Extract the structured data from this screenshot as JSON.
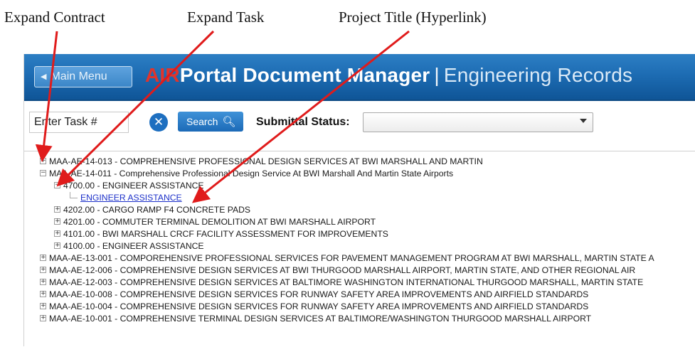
{
  "callouts": [
    "Expand Contract",
    "Expand Task",
    "Project Title (Hyperlink)"
  ],
  "header": {
    "main_menu_label": "Main Menu",
    "title_logo": "AIR",
    "title_rest": "Portal Document Manager",
    "title_separator": "|",
    "title_sub": "Engineering Records"
  },
  "toolbar": {
    "task_placeholder": "Enter Task #",
    "clear_symbol": "✕",
    "search_label": "Search",
    "status_label": "Submittal Status:",
    "status_value": ""
  },
  "tree": {
    "nodes": [
      {
        "toggle": "+",
        "text": "MAA-AE-14-013 - COMPREHENSIVE PROFESSIONAL DESIGN SERVICES AT BWI MARSHALL AND MARTIN"
      },
      {
        "toggle": "−",
        "text": "MAA-AE-14-011 - Comprehensive Professional Design Service At BWI Marshall And Martin State Airports"
      },
      {
        "toggle": "−",
        "text": "4700.00 - ENGINEER ASSISTANCE"
      },
      {
        "link": true,
        "text": "ENGINEER ASSISTANCE"
      },
      {
        "toggle": "+",
        "text": "4202.00 - CARGO RAMP F4 CONCRETE PADS"
      },
      {
        "toggle": "+",
        "text": "4201.00 - COMMUTER TERMINAL DEMOLITION AT BWI MARSHALL AIRPORT"
      },
      {
        "toggle": "+",
        "text": "4101.00 - BWI MARSHALL CRCF FACILITY ASSESSMENT FOR IMPROVEMENTS"
      },
      {
        "toggle": "+",
        "text": "4100.00 - ENGINEER ASSISTANCE"
      },
      {
        "toggle": "+",
        "text": "MAA-AE-13-001 - COMPOREHENSIVE PROFESSIONAL SERVICES FOR PAVEMENT MANAGEMENT PROGRAM AT BWI MARSHALL, MARTIN STATE A"
      },
      {
        "toggle": "+",
        "text": "MAA-AE-12-006 - COMPREHENSIVE DESIGN SERVICES AT BWI THURGOOD MARSHALL AIRPORT, MARTIN STATE, AND OTHER REGIONAL AIR"
      },
      {
        "toggle": "+",
        "text": "MAA-AE-12-003 - COMPREHENSIVE DESIGN SERVICES AT BALTIMORE WASHINGTON INTERNATIONAL THURGOOD MARSHALL, MARTIN STATE"
      },
      {
        "toggle": "+",
        "text": "MAA-AE-10-008 - COMPREHENSIVE DESIGN SERVICES FOR RUNWAY SAFETY AREA IMPROVEMENTS AND AIRFIELD STANDARDS"
      },
      {
        "toggle": "+",
        "text": "MAA-AE-10-004 - COMPREHENSIVE DESIGN SERVICES FOR RUNWAY SAFETY AREA IMPROVEMENTS AND AIRFIELD STANDARDS"
      },
      {
        "toggle": "+",
        "text": "MAA-AE-10-001 - COMPREHENSIVE TERMINAL DESIGN SERVICES AT BALTIMORE/WASHINGTON THURGOOD MARSHALL AIRPORT"
      }
    ]
  },
  "colors": {
    "header_blue": "#1d6cb3",
    "logo_red": "#e2342b",
    "link_blue": "#1c30c9",
    "annotation_arrow": "#e01b1b"
  }
}
